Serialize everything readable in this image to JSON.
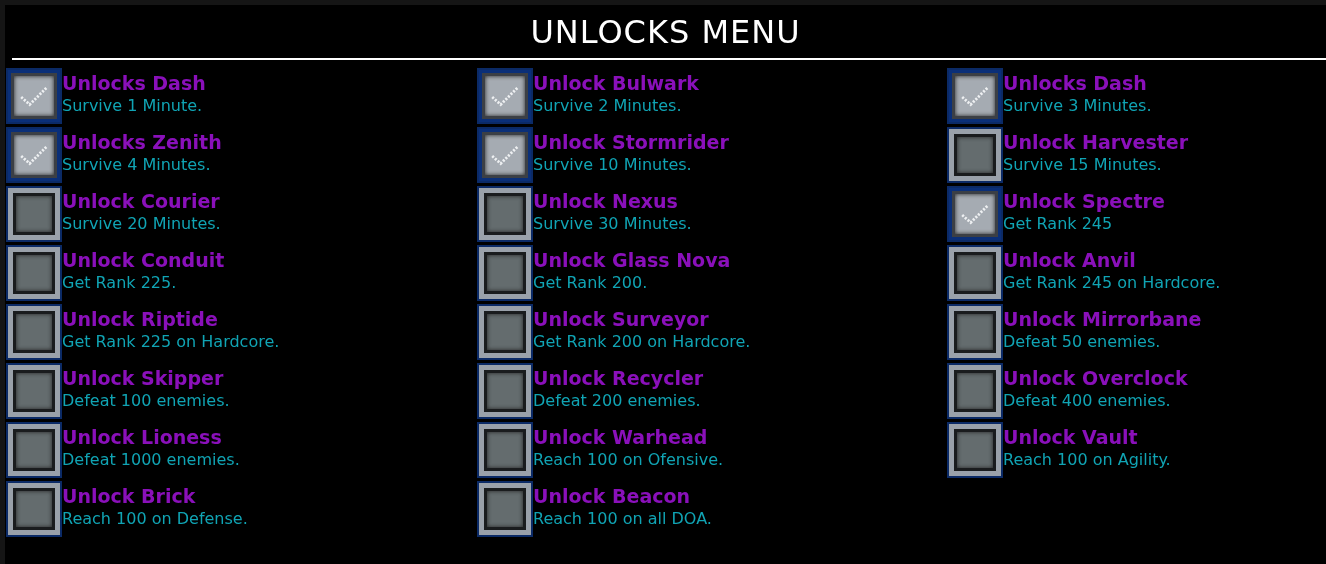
{
  "title": "UNLOCKS MENU",
  "columns": [
    {
      "items": [
        {
          "name": "Unlocks Dash",
          "requirement": "Survive 1 Minute.",
          "checked": true
        },
        {
          "name": "Unlocks Zenith",
          "requirement": "Survive 4 Minutes.",
          "checked": true
        },
        {
          "name": "Unlock Courier",
          "requirement": "Survive 20 Minutes.",
          "checked": false
        },
        {
          "name": "Unlock Conduit",
          "requirement": "Get Rank 225.",
          "checked": false
        },
        {
          "name": "Unlock Riptide",
          "requirement": "Get Rank 225 on Hardcore.",
          "checked": false
        },
        {
          "name": "Unlock Skipper",
          "requirement": "Defeat 100 enemies.",
          "checked": false
        },
        {
          "name": "Unlock Lioness",
          "requirement": "Defeat 1000 enemies.",
          "checked": false
        },
        {
          "name": "Unlock Brick",
          "requirement": "Reach 100 on Defense.",
          "checked": false
        }
      ]
    },
    {
      "items": [
        {
          "name": "Unlock Bulwark",
          "requirement": "Survive 2 Minutes.",
          "checked": true
        },
        {
          "name": "Unlock Stormrider",
          "requirement": "Survive 10 Minutes.",
          "checked": true
        },
        {
          "name": "Unlock Nexus",
          "requirement": "Survive 30 Minutes.",
          "checked": false
        },
        {
          "name": "Unlock Glass Nova",
          "requirement": "Get Rank 200.",
          "checked": false
        },
        {
          "name": "Unlock Surveyor",
          "requirement": "Get Rank 200 on Hardcore.",
          "checked": false
        },
        {
          "name": "Unlock Recycler",
          "requirement": "Defeat 200 enemies.",
          "checked": false
        },
        {
          "name": "Unlock Warhead",
          "requirement": "Reach 100 on Ofensive.",
          "checked": false
        },
        {
          "name": "Unlock Beacon",
          "requirement": "Reach 100 on all DOA.",
          "checked": false
        }
      ]
    },
    {
      "items": [
        {
          "name": "Unlocks Dash",
          "requirement": "Survive 3 Minutes.",
          "checked": true
        },
        {
          "name": "Unlock Harvester",
          "requirement": "Survive 15 Minutes.",
          "checked": false
        },
        {
          "name": "Unlock Spectre",
          "requirement": "Get Rank 245",
          "checked": true
        },
        {
          "name": "Unlock Anvil",
          "requirement": "Get Rank 245 on Hardcore.",
          "checked": false
        },
        {
          "name": "Unlock Mirrorbane",
          "requirement": "Defeat 50 enemies.",
          "checked": false
        },
        {
          "name": "Unlock Overclock",
          "requirement": "Defeat 400 enemies.",
          "checked": false
        },
        {
          "name": "Unlock Vault",
          "requirement": "Reach 100 on Agility.",
          "checked": false
        }
      ]
    }
  ]
}
